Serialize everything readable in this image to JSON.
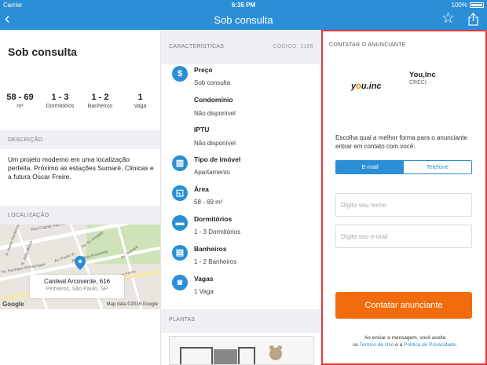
{
  "status": {
    "carrier": "Carrier",
    "time": "6:35 PM",
    "battery": "100%"
  },
  "nav": {
    "back_icon": "chevron-left-icon",
    "title": "Sob consulta",
    "fav_icon": "star-icon",
    "share_icon": "share-icon"
  },
  "summary": {
    "title": "Sob consulta",
    "stats": [
      {
        "value": "58 - 69",
        "label": "m²"
      },
      {
        "value": "1 - 3",
        "label": "Dormitórios"
      },
      {
        "value": "1 - 2",
        "label": "Banheiros"
      },
      {
        "value": "1",
        "label": "Vaga"
      }
    ]
  },
  "description": {
    "header": "DESCRIÇÃO",
    "text": "Um projeto moderno em uma localização perfeita. Próximo as estações Sumaré, Clinicas e a futura Oscar Freire."
  },
  "location": {
    "header": "LOCALIZAÇÃO",
    "address": "Cardeal Arcoverde, 616",
    "neighborhood": "Pinheiros, São Paulo, SP",
    "google": "Google",
    "map_data": "Map data ©2016 Google",
    "streets": [
      "R. Cardeal Arcoverde",
      "Av. Dr. Arnaldo",
      "R. Heitor Penteado",
      "Av. Paulo VI",
      "R. João Moura",
      "R. Oscar Freire",
      "Rua Capote Valente",
      "Av. Henrique Schaumann",
      "Av. Sumaré"
    ]
  },
  "features": {
    "header": "CARACTERÍSTICAS",
    "code": "CÓDIGO: 2186",
    "items": [
      {
        "icon": "dollar-icon",
        "title": "Preço",
        "value": "Sob consulta"
      },
      {
        "icon": "",
        "title": "Condomínio",
        "value": "Não disponível"
      },
      {
        "icon": "",
        "title": "IPTU",
        "value": "Não disponível"
      },
      {
        "icon": "building-icon",
        "title": "Tipo de imóvel",
        "value": "Apartamento"
      },
      {
        "icon": "area-icon",
        "title": "Área",
        "value": "58 - 69 m²"
      },
      {
        "icon": "bed-icon",
        "title": "Dormitórios",
        "value": "1 - 3 Dormitórios"
      },
      {
        "icon": "bath-icon",
        "title": "Banheiros",
        "value": "1 - 2 Banheiros"
      },
      {
        "icon": "car-icon",
        "title": "Vagas",
        "value": "1 Vaga"
      }
    ],
    "plantas_header": "PLANTAS"
  },
  "contact": {
    "header": "CONTATAR O ANUNCIANTE",
    "logo": "you.inc",
    "advertiser": "You,Inc",
    "creci": "CRECI: -",
    "prompt": "Escolha qual a melhor forma para o anunciante entrar em contato com você:",
    "tab_email": "E-mail",
    "tab_phone": "Telefone",
    "name_placeholder": "Digite seu nome",
    "email_placeholder": "Digite seu e-mail",
    "submit": "Contatar anunciante",
    "terms_prefix": "Ao enviar a mensagem, você aceita",
    "terms_os": "os ",
    "terms_link": "Termos de Uso",
    "terms_and": " e a ",
    "privacy_link": "Política de Privacidade",
    "terms_end": "."
  },
  "colors": {
    "brand": "#2a8fd6",
    "cta": "#f26c0d",
    "highlight_border": "#e03a3a"
  }
}
